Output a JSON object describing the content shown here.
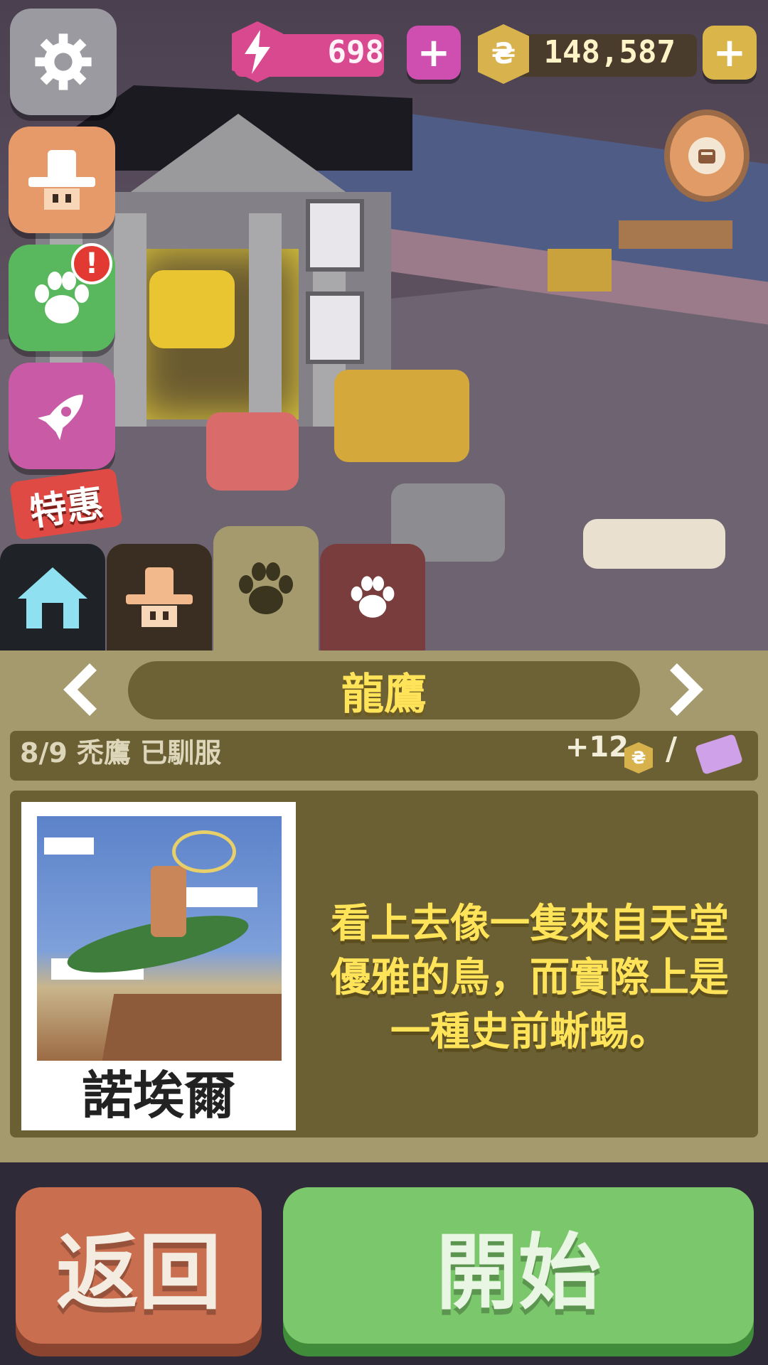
{
  "hud": {
    "energy": "698",
    "coins": "148,587",
    "energy_plus": "+",
    "coin_plus": "+",
    "coin_symbol": "₴",
    "alert_badge": "!",
    "promo_label": "特惠"
  },
  "panel": {
    "title": "龍鷹",
    "progress": "8/9  禿鷹  已馴服",
    "reward": "+12",
    "reward_coin_symbol": "₴",
    "separator": "/",
    "card_name": "諾埃爾",
    "description_lines": [
      "看上去像一隻來自天堂",
      "優雅的鳥，而實際上是",
      "一種史前蜥蜴。"
    ]
  },
  "buttons": {
    "back": "返回",
    "start": "開始"
  },
  "colors": {
    "panel": "#a59a6e",
    "panel_dark": "#6b6034",
    "accent_text": "#ffe45a",
    "energy": "#d9498f",
    "coin": "#d8b24d",
    "back_button": "#c96e4f",
    "start_button": "#7bc76b"
  },
  "icons": [
    "gear-icon",
    "cowboy-hat-icon",
    "paw-icon",
    "rocket-icon",
    "lightning-icon",
    "coin-icon",
    "plus-icon",
    "map-pin-icon",
    "house-icon",
    "ticket-icon",
    "chevron-left-icon",
    "chevron-right-icon"
  ]
}
